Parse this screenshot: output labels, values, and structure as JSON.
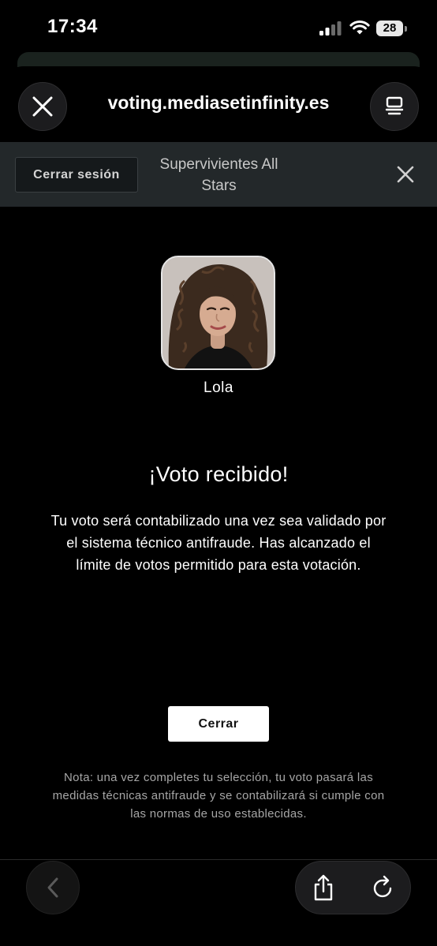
{
  "status_bar": {
    "time": "17:34",
    "battery": "28"
  },
  "browser": {
    "url": "voting.mediasetinfinity.es"
  },
  "header": {
    "logout_label": "Cerrar sesión",
    "title": "Supervivientes All Stars"
  },
  "candidate": {
    "name": "Lola"
  },
  "confirmation": {
    "title": "¡Voto recibido!",
    "message": "Tu voto será contabilizado una vez sea validado por el sistema técnico antifraude. Has alcanzado el límite de votos permitido para esta votación.",
    "close_label": "Cerrar",
    "note": "Nota: una vez completes tu selección, tu voto pasará las medidas técnicas antifraude y se contabilizará si cumple con las normas de uso establecidas."
  },
  "icons": {
    "close_tab": "close-icon",
    "reader": "reader-mode-icon",
    "header_close": "close-icon",
    "back": "chevron-left-icon",
    "share": "share-icon",
    "reload": "reload-icon"
  },
  "colors": {
    "background": "#000000",
    "header": "#23282a",
    "button": "#ffffff"
  }
}
